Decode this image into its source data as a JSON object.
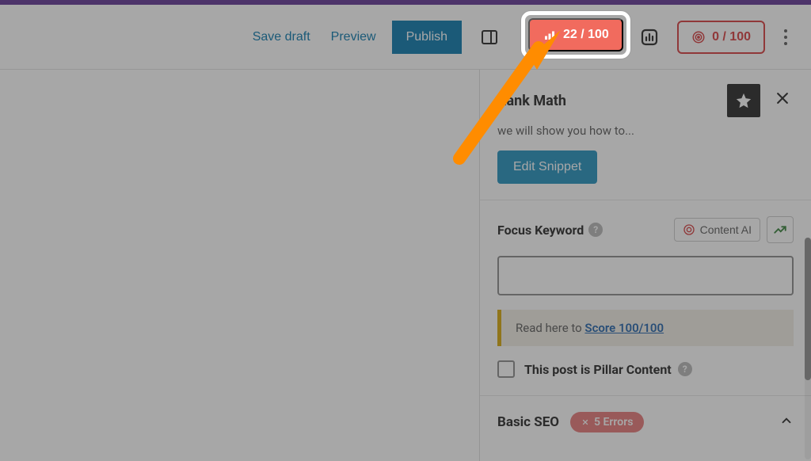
{
  "toolbar": {
    "save_draft": "Save draft",
    "preview": "Preview",
    "publish": "Publish",
    "score_main": "22 / 100",
    "score_secondary": "0 / 100"
  },
  "sidebar": {
    "title": "Rank Math",
    "snippet_preview_text": "we will show you how to...",
    "edit_snippet": "Edit Snippet",
    "focus_keyword_label": "Focus Keyword",
    "content_ai": "Content AI",
    "focus_keyword_value": "",
    "score_banner_prefix": "Read here to ",
    "score_banner_link": "Score 100/100",
    "pillar_label": "This post is Pillar Content",
    "basic_seo": "Basic SEO",
    "errors_count": "5 Errors"
  }
}
